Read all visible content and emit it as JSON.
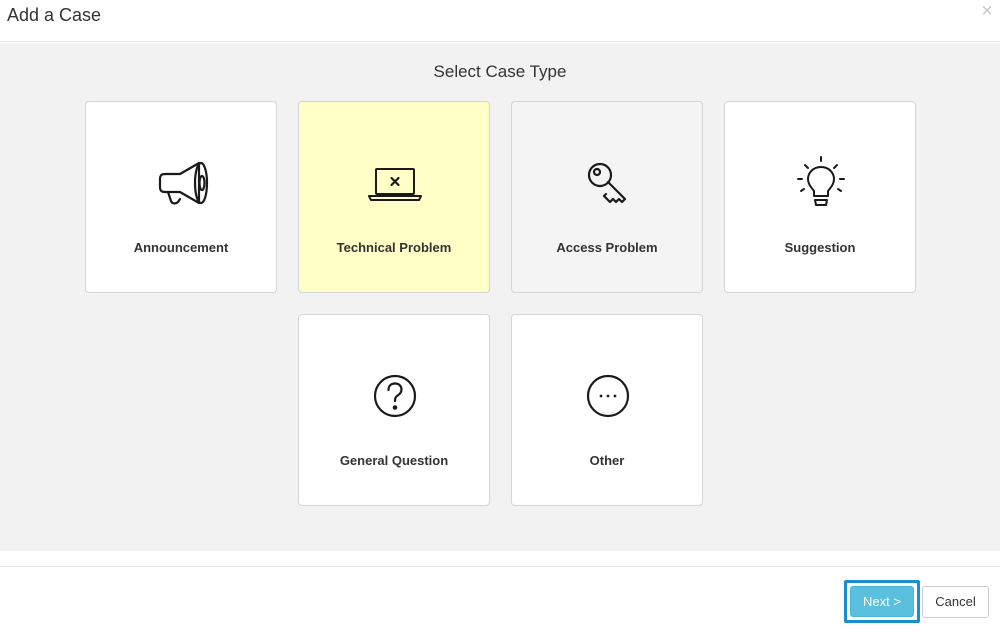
{
  "modal": {
    "title": "Add a Case",
    "close_symbol": "×"
  },
  "body": {
    "section_title": "Select Case Type",
    "case_types": [
      {
        "label": "Announcement",
        "icon": "megaphone-icon",
        "state": "default"
      },
      {
        "label": "Technical Problem",
        "icon": "laptop-error-icon",
        "state": "selected"
      },
      {
        "label": "Access Problem",
        "icon": "key-icon",
        "state": "hover"
      },
      {
        "label": "Suggestion",
        "icon": "lightbulb-icon",
        "state": "default"
      },
      {
        "label": "General Question",
        "icon": "question-circle-icon",
        "state": "default"
      },
      {
        "label": "Other",
        "icon": "ellipsis-circle-icon",
        "state": "default"
      }
    ]
  },
  "footer": {
    "next_label": "Next >",
    "cancel_label": "Cancel"
  },
  "colors": {
    "selected_tile": "#ffffc8",
    "hover_tile": "#f4f4f4",
    "primary_button": "#5bc0de",
    "focus_ring": "#1a8fd0",
    "body_background": "#f2f2f2"
  }
}
